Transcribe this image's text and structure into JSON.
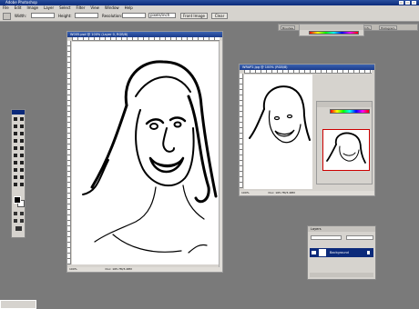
{
  "app": {
    "title": "Adobe Photoshop"
  },
  "menu": [
    "File",
    "Edit",
    "Image",
    "Layer",
    "Select",
    "Filter",
    "View",
    "Window",
    "Help"
  ],
  "options": {
    "width_label": "Width:",
    "width_value": "",
    "height_label": "Height:",
    "height_value": "",
    "resolution_label": "Resolution:",
    "resolution_unit": "pixels/inch",
    "front_image_label": "Front Image",
    "clear_label": "Clear"
  },
  "palette_well": {
    "tabs": [
      "Brushes",
      "History",
      "Navigator",
      "Info",
      "Histogram"
    ]
  },
  "docs": {
    "main": {
      "title": "W005.psd @ 100% (Layer 0, RGB/8)",
      "status_zoom": "100%",
      "status_info": "Doc: 165.7M/3.48M"
    },
    "second": {
      "title": "WRAP2.jpg @ 100% (RGB/8)",
      "status_zoom": "100%",
      "status_info": "Doc: 165.7M/3.48M"
    }
  },
  "navigator": {
    "tabs": [
      "Navigator",
      "Color"
    ]
  },
  "layers": {
    "title": "Layers",
    "layer_name": "Background"
  },
  "colors": {
    "title_blue": "#0c2a7a",
    "chrome": "#d6d3ce",
    "workspace": "#7a7a7a"
  }
}
